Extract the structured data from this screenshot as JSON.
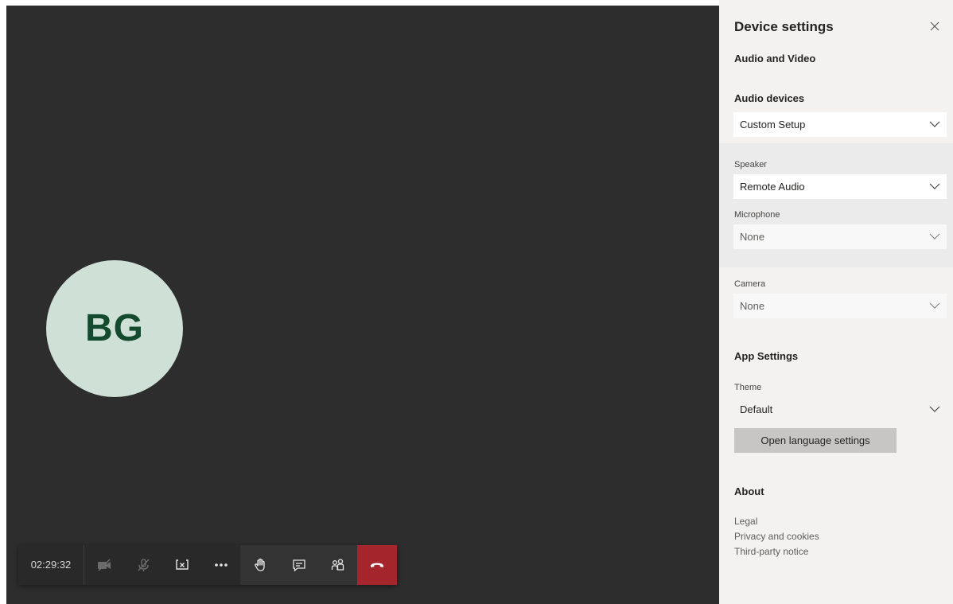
{
  "call": {
    "participant_initials": "BG",
    "timer": "02:29:32",
    "controls": [
      "camera-off-icon",
      "mic-off-icon",
      "stop-share-icon",
      "more-icon",
      "raise-hand-icon",
      "chat-icon",
      "participants-icon",
      "hang-up-icon"
    ],
    "hangup_color": "#a4262c",
    "avatar_bg": "#cfe0d7",
    "avatar_fg": "#144a2d"
  },
  "settings": {
    "title": "Device settings",
    "audio_video_heading": "Audio and Video",
    "audio_devices_heading": "Audio devices",
    "audio_devices_value": "Custom Setup",
    "speaker_label": "Speaker",
    "speaker_value": "Remote Audio",
    "microphone_label": "Microphone",
    "microphone_value": "None",
    "camera_label": "Camera",
    "camera_value": "None",
    "app_settings_heading": "App Settings",
    "theme_label": "Theme",
    "theme_value": "Default",
    "language_button": "Open language settings",
    "about_heading": "About",
    "links": {
      "legal": "Legal",
      "privacy": "Privacy and cookies",
      "third_party": "Third-party notice"
    }
  }
}
